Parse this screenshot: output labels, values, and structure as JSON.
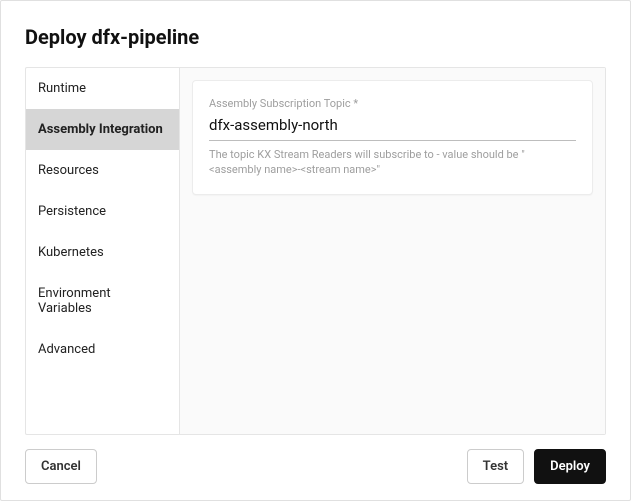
{
  "dialog": {
    "title": "Deploy dfx-pipeline"
  },
  "sidebar": {
    "items": [
      {
        "label": "Runtime"
      },
      {
        "label": "Assembly Integration"
      },
      {
        "label": "Resources"
      },
      {
        "label": "Persistence"
      },
      {
        "label": "Kubernetes"
      },
      {
        "label": "Environment Variables"
      },
      {
        "label": "Advanced"
      }
    ]
  },
  "form": {
    "subscriptionTopic": {
      "label": "Assembly Subscription Topic *",
      "value": "dfx-assembly-north",
      "help": "The topic KX Stream Readers will subscribe to - value should be \"<assembly name>-<stream name>\""
    }
  },
  "actions": {
    "cancel": "Cancel",
    "test": "Test",
    "deploy": "Deploy"
  }
}
